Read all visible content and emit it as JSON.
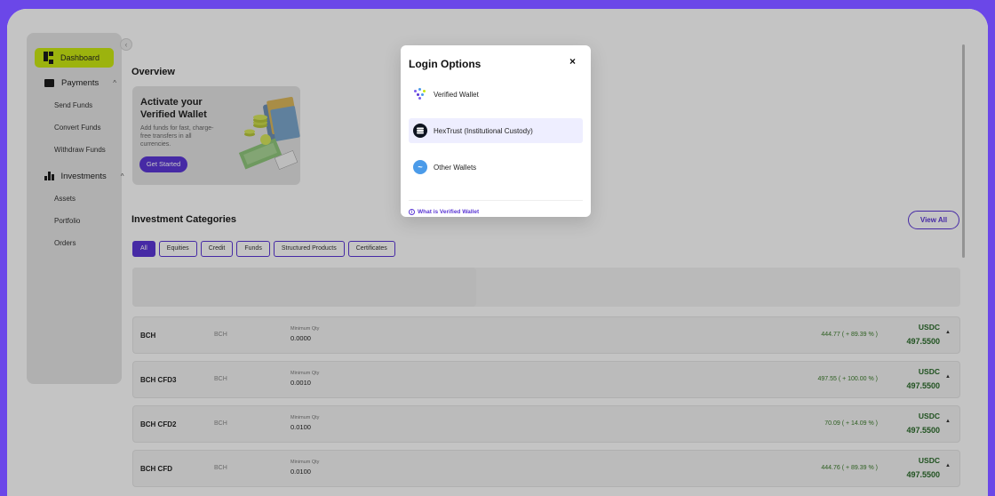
{
  "sidebar": {
    "dashboard": "Dashboard",
    "payments": {
      "label": "Payments",
      "items": [
        "Send Funds",
        "Convert Funds",
        "Withdraw Funds"
      ]
    },
    "investments": {
      "label": "Investments",
      "items": [
        "Assets",
        "Portfolio",
        "Orders"
      ]
    }
  },
  "overview": {
    "heading": "Overview",
    "promo_title": "Activate your Verified Wallet",
    "promo_text": "Add funds for fast, charge-free transfers in all currencies.",
    "promo_button": "Get Started"
  },
  "categories": {
    "heading": "Investment Categories",
    "view_all": "View All",
    "filters": [
      "All",
      "Equities",
      "Credit",
      "Funds",
      "Structured Products",
      "Certificates"
    ]
  },
  "assets": [
    {
      "name": "BCH",
      "symbol": "BCH",
      "min_label": "Minimum Qty",
      "min_qty": "0.0000",
      "perf": "444.77 ( + 89.39 % )",
      "currency": "USDC",
      "price": "497.5500"
    },
    {
      "name": "BCH CFD3",
      "symbol": "BCH",
      "min_label": "Minimum Qty",
      "min_qty": "0.0010",
      "perf": "497.55 ( + 100.00 % )",
      "currency": "USDC",
      "price": "497.5500"
    },
    {
      "name": "BCH CFD2",
      "symbol": "BCH",
      "min_label": "Minimum Qty",
      "min_qty": "0.0100",
      "perf": "70.09 ( + 14.09 % )",
      "currency": "USDC",
      "price": "497.5500"
    },
    {
      "name": "BCH CFD",
      "symbol": "BCH",
      "min_label": "Minimum Qty",
      "min_qty": "0.0100",
      "perf": "444.76 ( + 89.39 % )",
      "currency": "USDC",
      "price": "497.5500"
    }
  ],
  "modal": {
    "title": "Login Options",
    "close": "×",
    "options": [
      "Verified Wallet",
      "HexTrust (Institutional Custody)",
      "Other Wallets"
    ],
    "help": "What is Verified Wallet"
  },
  "colors": {
    "accent": "#5a36d4",
    "active_nav": "#c8e612",
    "frame": "#6b47e8",
    "positive": "#2a6a2a"
  }
}
